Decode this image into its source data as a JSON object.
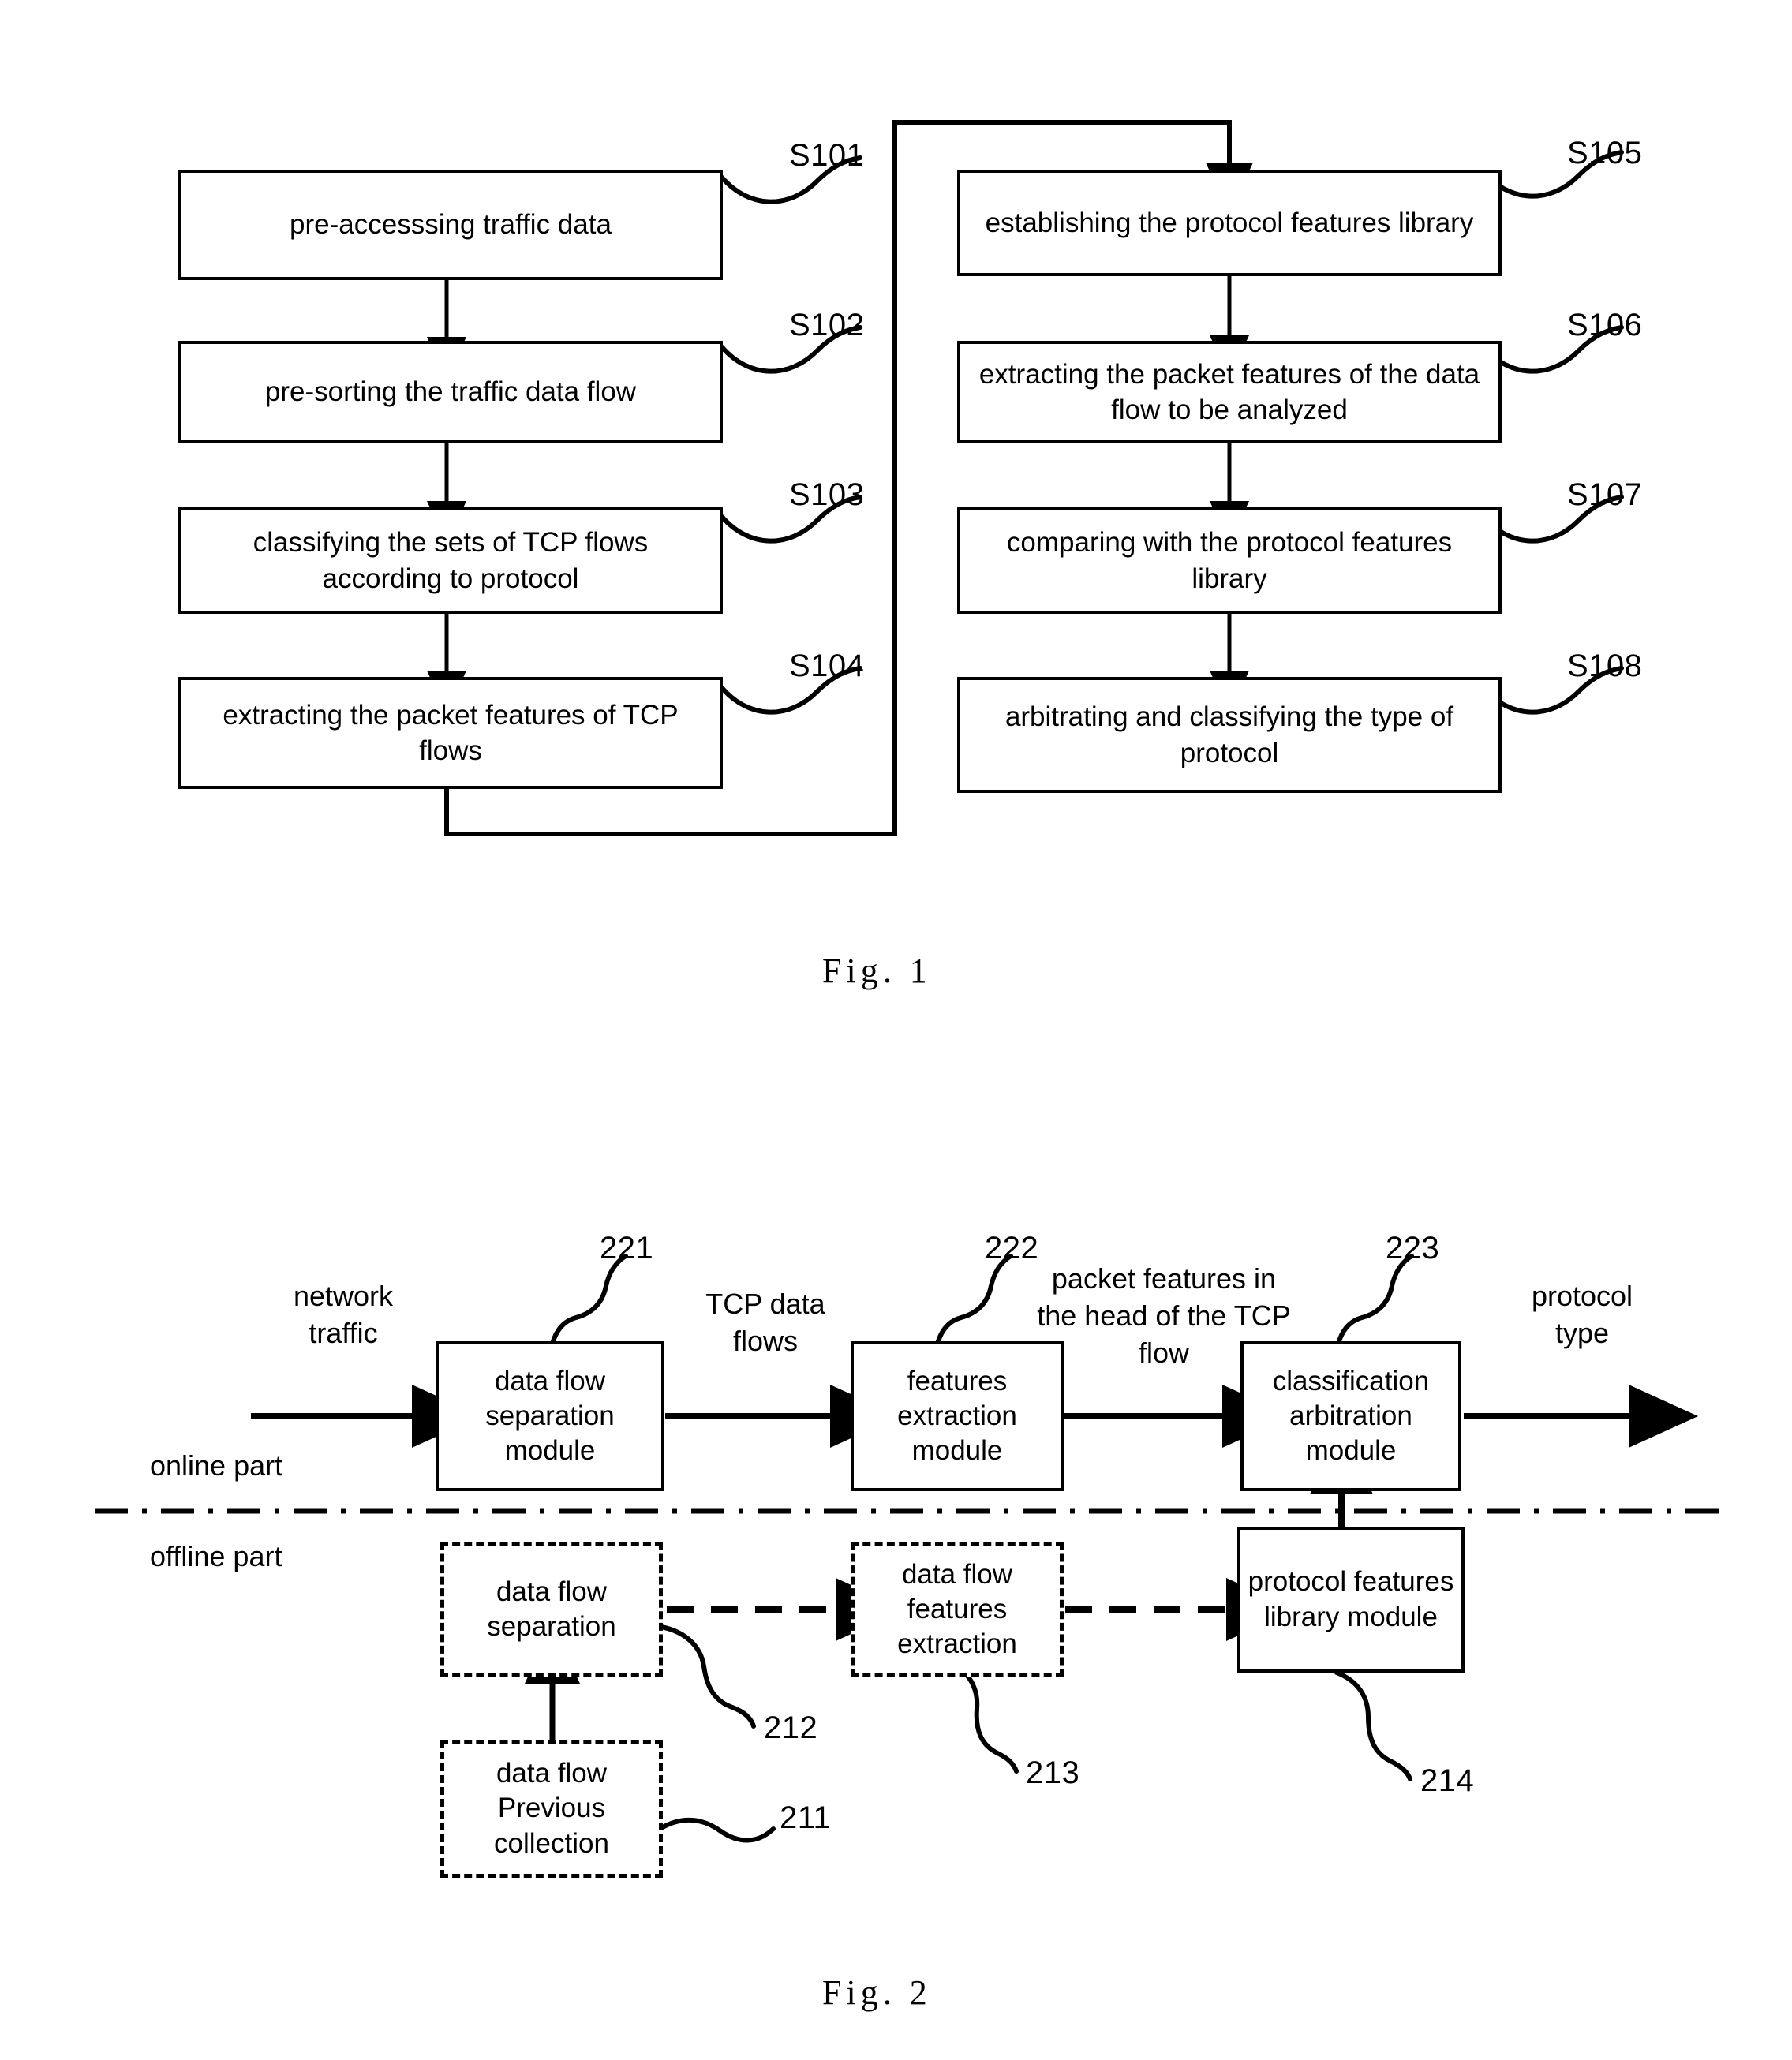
{
  "figure1": {
    "caption": "Fig.  1",
    "left_column": [
      {
        "text": "pre-accesssing traffic data",
        "ref": "S101"
      },
      {
        "text": "pre-sorting the traffic data flow",
        "ref": "S102"
      },
      {
        "text": "classifying the sets of TCP flows according to protocol",
        "ref": "S103"
      },
      {
        "text": "extracting the packet features of TCP flows",
        "ref": "S104"
      }
    ],
    "right_column": [
      {
        "text": "establishing the protocol features library",
        "ref": "S105"
      },
      {
        "text": "extracting the packet features of the data flow to be analyzed",
        "ref": "S106"
      },
      {
        "text": "comparing with the protocol features library",
        "ref": "S107"
      },
      {
        "text": "arbitrating and classifying the type of protocol",
        "ref": "S108"
      }
    ]
  },
  "figure2": {
    "caption": "Fig.  2",
    "section_labels": {
      "online": "online part",
      "offline": "offline part"
    },
    "flow_labels": {
      "input": "network\ntraffic",
      "tcp_data_flows": "TCP data\nflows",
      "packet_features": "packet features in\nthe head of the TCP\nflow",
      "output": "protocol\ntype"
    },
    "online_modules": [
      {
        "text": "data flow separation module",
        "ref": "221"
      },
      {
        "text": "features extraction module",
        "ref": "222"
      },
      {
        "text": "classification arbitration module",
        "ref": "223"
      }
    ],
    "offline_modules": [
      {
        "text": "data flow separation",
        "ref": "212"
      },
      {
        "text": "data flow features extraction",
        "ref": "213"
      },
      {
        "text": "protocol features library module",
        "ref": "214"
      },
      {
        "text": "data flow Previous collection",
        "ref": "211"
      }
    ]
  }
}
